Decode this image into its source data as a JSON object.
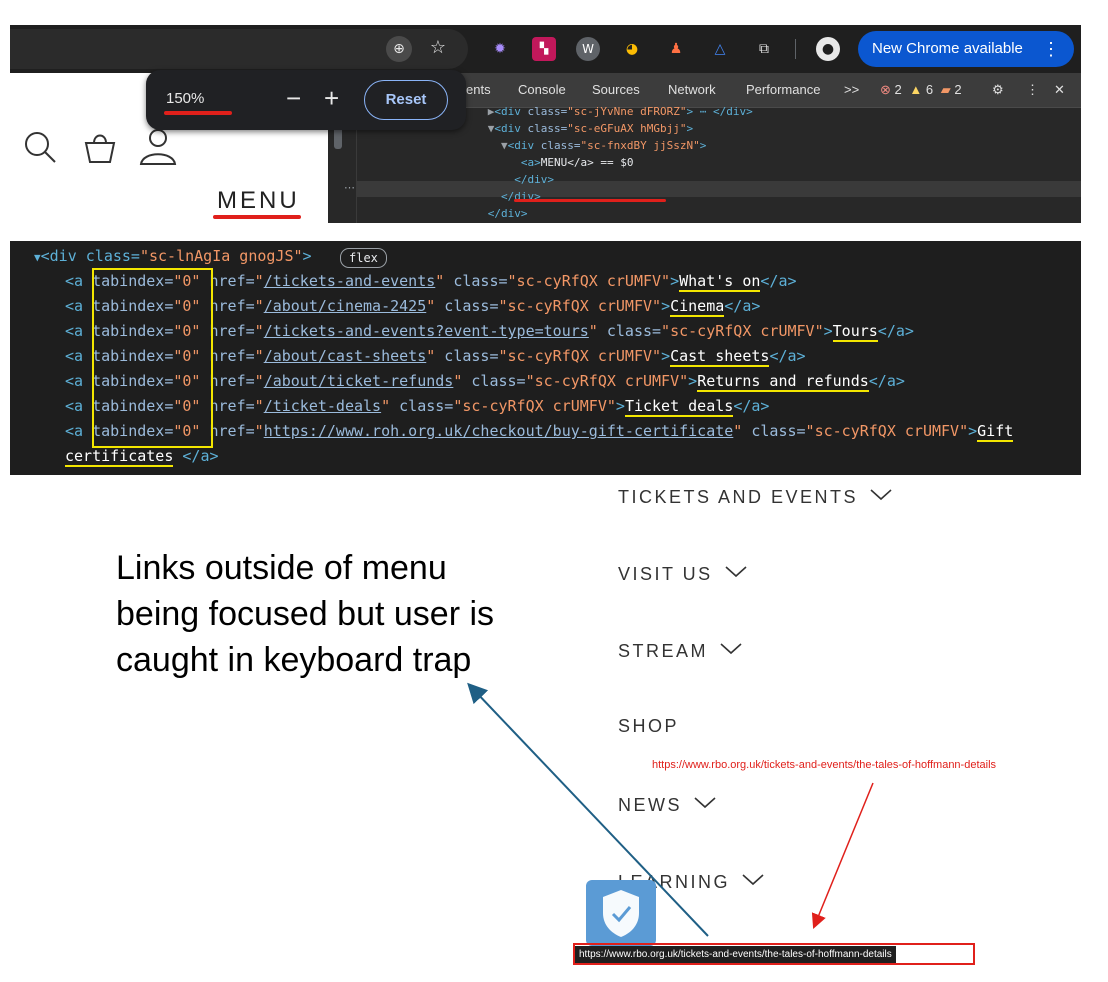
{
  "browser": {
    "zoom_value": "150%",
    "zoom_minus": "−",
    "zoom_plus": "+",
    "zoom_reset": "Reset",
    "new_chrome": "New Chrome available",
    "menu_label": "MENU"
  },
  "devtools": {
    "tabs": [
      "ents",
      "Console",
      "Sources",
      "Network",
      "Performance",
      ">>"
    ],
    "errors": "2",
    "warnings": "6",
    "issues": "2",
    "lines": [
      {
        "indent": "      ",
        "arrow": "▶",
        "open": "<div ",
        "attr": "class=",
        "val": "\"sc-jYvNne dFRORZ\"",
        "tail": "> ⋯ </div>"
      },
      {
        "indent": "      ",
        "arrow": "▼",
        "open": "<div ",
        "attr": "class=",
        "val": "\"sc-eGFuAX hMGbjj\"",
        "tail": ">"
      },
      {
        "indent": "        ",
        "arrow": "▼",
        "open": "<div ",
        "attr": "class=",
        "val": "\"sc-fnxdBY jjSszN\"",
        "tail": ">"
      },
      {
        "indent": "           ",
        "arrow": "",
        "open": "<a>",
        "attr": "",
        "val": "",
        "tail": "MENU</a> == $0"
      },
      {
        "indent": "          ",
        "arrow": "",
        "open": "</div>",
        "attr": "",
        "val": "",
        "tail": ""
      },
      {
        "indent": "        ",
        "arrow": "",
        "open": "</div>",
        "attr": "",
        "val": "",
        "tail": ""
      },
      {
        "indent": "      ",
        "arrow": "",
        "open": "</div>",
        "attr": "",
        "val": "",
        "tail": ""
      }
    ]
  },
  "code": {
    "container_open": "<div class=",
    "container_class": "\"sc-lnAgIa gnogJS\"",
    "container_close": ">",
    "flex_badge": "flex",
    "tabindex_attr": "tabindex=",
    "tabindex_val": "\"0\"",
    "link_class": "\"sc-cyRfQX crUMFV\"",
    "links": [
      {
        "href": "/tickets-and-events",
        "text": "What's on"
      },
      {
        "href": "/about/cinema-2425",
        "text": "Cinema"
      },
      {
        "href": "/tickets-and-events?event-type=tours",
        "text": "Tours"
      },
      {
        "href": "/about/cast-sheets",
        "text": "Cast sheets"
      },
      {
        "href": "/about/ticket-refunds",
        "text": "Returns and refunds"
      },
      {
        "href": "/ticket-deals",
        "text": "Ticket deals"
      },
      {
        "href": "https://www.roh.org.uk/checkout/buy-gift-certificate",
        "text": "Gift"
      }
    ],
    "last_line_text": "certificates",
    "last_line_close": " </a>"
  },
  "annotation": "Links outside of menu being focused but user is caught in keyboard trap",
  "nav": {
    "items": [
      "TICKETS AND EVENTS",
      "VISIT US",
      "STREAM",
      "SHOP",
      "NEWS",
      "LEARNING"
    ]
  },
  "url_note": "https://www.rbo.org.uk/tickets-and-events/the-tales-of-hoffmann-details",
  "status_url": "https://www.rbo.org.uk/tickets-and-events/the-tales-of-hoffmann-details",
  "colors": {
    "red": "#e0201b",
    "yellow": "#f3e600",
    "blue_arrow": "#1f5f85",
    "chrome_blue": "#0b57d0"
  }
}
